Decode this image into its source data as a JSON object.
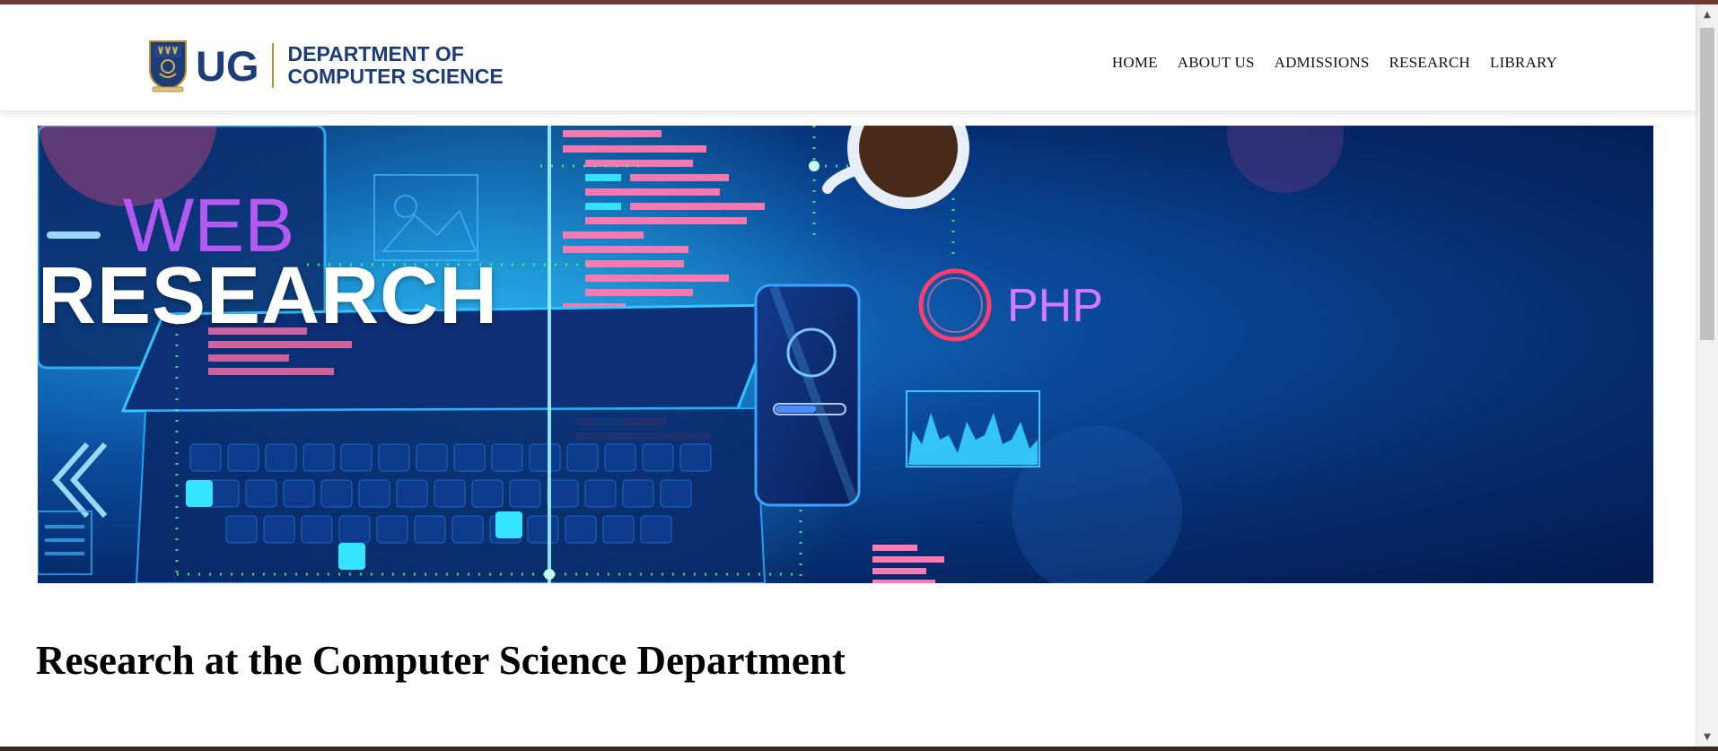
{
  "header": {
    "logo": {
      "short": "UG",
      "line1": "DEPARTMENT OF",
      "line2": "COMPUTER SCIENCE"
    },
    "nav": [
      {
        "label": "HOME"
      },
      {
        "label": "ABOUT US"
      },
      {
        "label": "ADMISSIONS"
      },
      {
        "label": "RESEARCH"
      },
      {
        "label": "LIBRARY"
      }
    ]
  },
  "hero": {
    "title": "RESEARCH",
    "art_labels": {
      "web": "WEB",
      "php": "PHP"
    }
  },
  "main": {
    "heading": "Research at the Computer Science Department"
  },
  "colors": {
    "brand_blue": "#1d3c78",
    "brand_gold": "#b98e2d",
    "top_accent": "#6e3b38",
    "hero_dark": "#041a4e"
  },
  "icons": {
    "crest": "university-crest-icon",
    "scroll_up": "chevron-up-icon",
    "scroll_down": "chevron-down-icon"
  }
}
